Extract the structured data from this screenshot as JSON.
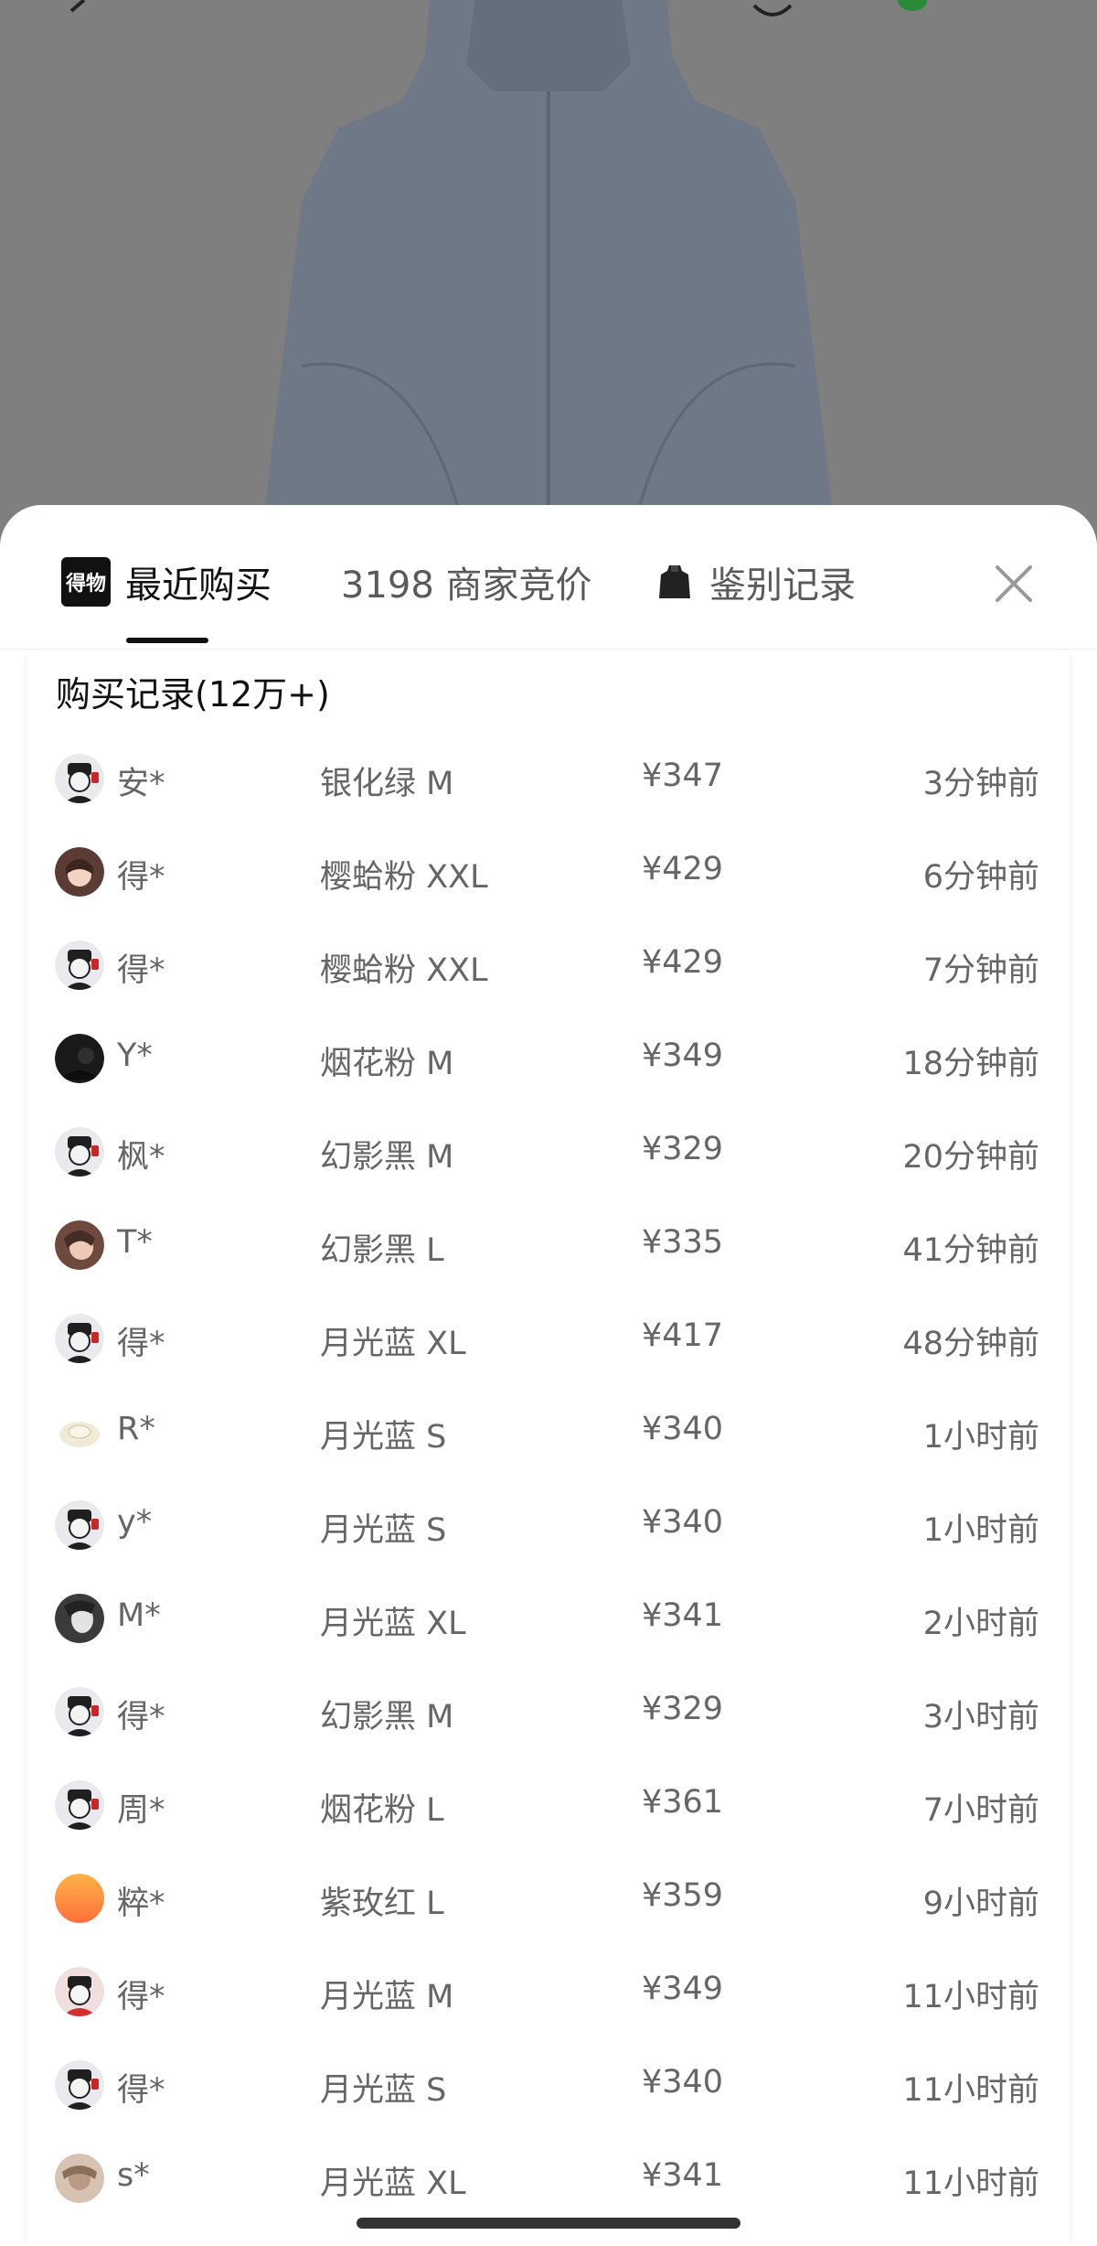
{
  "tabs": {
    "logo_text": "得物",
    "recent": "最近购买",
    "bids": "3198 商家竞价",
    "auth": "鉴别记录"
  },
  "section_title": "购买记录(12万+)",
  "colors": {
    "text_primary": "#111111",
    "text_secondary": "#666666",
    "sheet_bg": "#ffffff",
    "overlay_bg": "#808080"
  },
  "records": [
    {
      "user": "安*",
      "sku": "银化绿 M",
      "price": "¥347",
      "time": "3分钟前",
      "avatar": "mascot"
    },
    {
      "user": "得*",
      "sku": "樱蛤粉 XXL",
      "price": "¥429",
      "time": "6分钟前",
      "avatar": "girl"
    },
    {
      "user": "得*",
      "sku": "樱蛤粉 XXL",
      "price": "¥429",
      "time": "7分钟前",
      "avatar": "mascot"
    },
    {
      "user": "Y*",
      "sku": "烟花粉 M",
      "price": "¥349",
      "time": "18分钟前",
      "avatar": "dark"
    },
    {
      "user": "枫*",
      "sku": "幻影黑 M",
      "price": "¥329",
      "time": "20分钟前",
      "avatar": "mascot"
    },
    {
      "user": "T*",
      "sku": "幻影黑 L",
      "price": "¥335",
      "time": "41分钟前",
      "avatar": "girl2"
    },
    {
      "user": "得*",
      "sku": "月光蓝 XL",
      "price": "¥417",
      "time": "48分钟前",
      "avatar": "mascot"
    },
    {
      "user": "R*",
      "sku": "月光蓝 S",
      "price": "¥340",
      "time": "1小时前",
      "avatar": "bun"
    },
    {
      "user": "y*",
      "sku": "月光蓝 S",
      "price": "¥340",
      "time": "1小时前",
      "avatar": "mascot"
    },
    {
      "user": "M*",
      "sku": "月光蓝 XL",
      "price": "¥341",
      "time": "2小时前",
      "avatar": "grayface"
    },
    {
      "user": "得*",
      "sku": "幻影黑 M",
      "price": "¥329",
      "time": "3小时前",
      "avatar": "mascot"
    },
    {
      "user": "周*",
      "sku": "烟花粉 L",
      "price": "¥361",
      "time": "7小时前",
      "avatar": "mascot"
    },
    {
      "user": "粹*",
      "sku": "紫玫红 L",
      "price": "¥359",
      "time": "9小时前",
      "avatar": "sunset"
    },
    {
      "user": "得*",
      "sku": "月光蓝 M",
      "price": "¥349",
      "time": "11小时前",
      "avatar": "redmascot"
    },
    {
      "user": "得*",
      "sku": "月光蓝 S",
      "price": "¥340",
      "time": "11小时前",
      "avatar": "mascot"
    },
    {
      "user": "s*",
      "sku": "月光蓝 XL",
      "price": "¥341",
      "time": "11小时前",
      "avatar": "beige"
    }
  ]
}
